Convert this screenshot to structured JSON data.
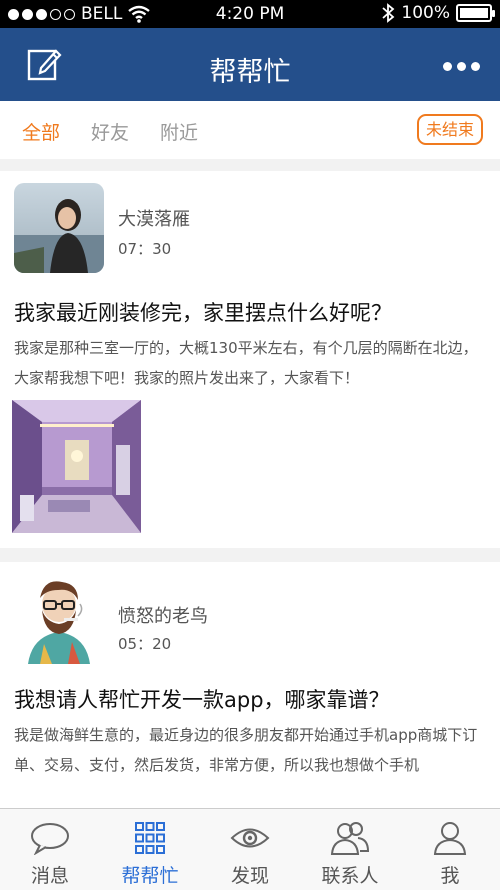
{
  "status_bar": {
    "carrier": "BELL",
    "time": "4:20 PM",
    "battery": "100%",
    "battery_level": 1.0
  },
  "header": {
    "title": "帮帮忙",
    "edit_icon": "compose-icon",
    "more_icon": "more-icon"
  },
  "filters": {
    "tabs": [
      {
        "label": "全部",
        "active": true
      },
      {
        "label": "好友",
        "active": false
      },
      {
        "label": "附近",
        "active": false
      }
    ],
    "status_button": "未结束"
  },
  "posts": [
    {
      "user": "大漠落雁",
      "time": "07：30",
      "title": "我家最近刚装修完，家里摆点什么好呢？",
      "body": "我家是那种三室一厅的，大概130平米左右，有个几层的隔断在北边，大家帮我想下吧！我家的照片发出来了，大家看下！"
    },
    {
      "user": "愤怒的老鸟",
      "time": "05：20",
      "title": "我想请人帮忙开发一款app，哪家靠谱？",
      "body": "我是做海鲜生意的，最近身边的很多朋友都开始通过手机app商城下订单、交易、支付，然后发货，非常方便，所以我也想做个手机"
    }
  ],
  "tab_bar": {
    "items": [
      {
        "label": "消息",
        "icon": "chat-bubble-icon",
        "active": false
      },
      {
        "label": "帮帮忙",
        "icon": "grid-icon",
        "active": true
      },
      {
        "label": "发现",
        "icon": "eye-icon",
        "active": false
      },
      {
        "label": "联系人",
        "icon": "contacts-icon",
        "active": false
      },
      {
        "label": "我",
        "icon": "person-icon",
        "active": false
      }
    ]
  },
  "colors": {
    "nav_blue": "#244f8b",
    "accent_orange": "#f07a1e",
    "active_tab_blue": "#2c6fd6"
  }
}
